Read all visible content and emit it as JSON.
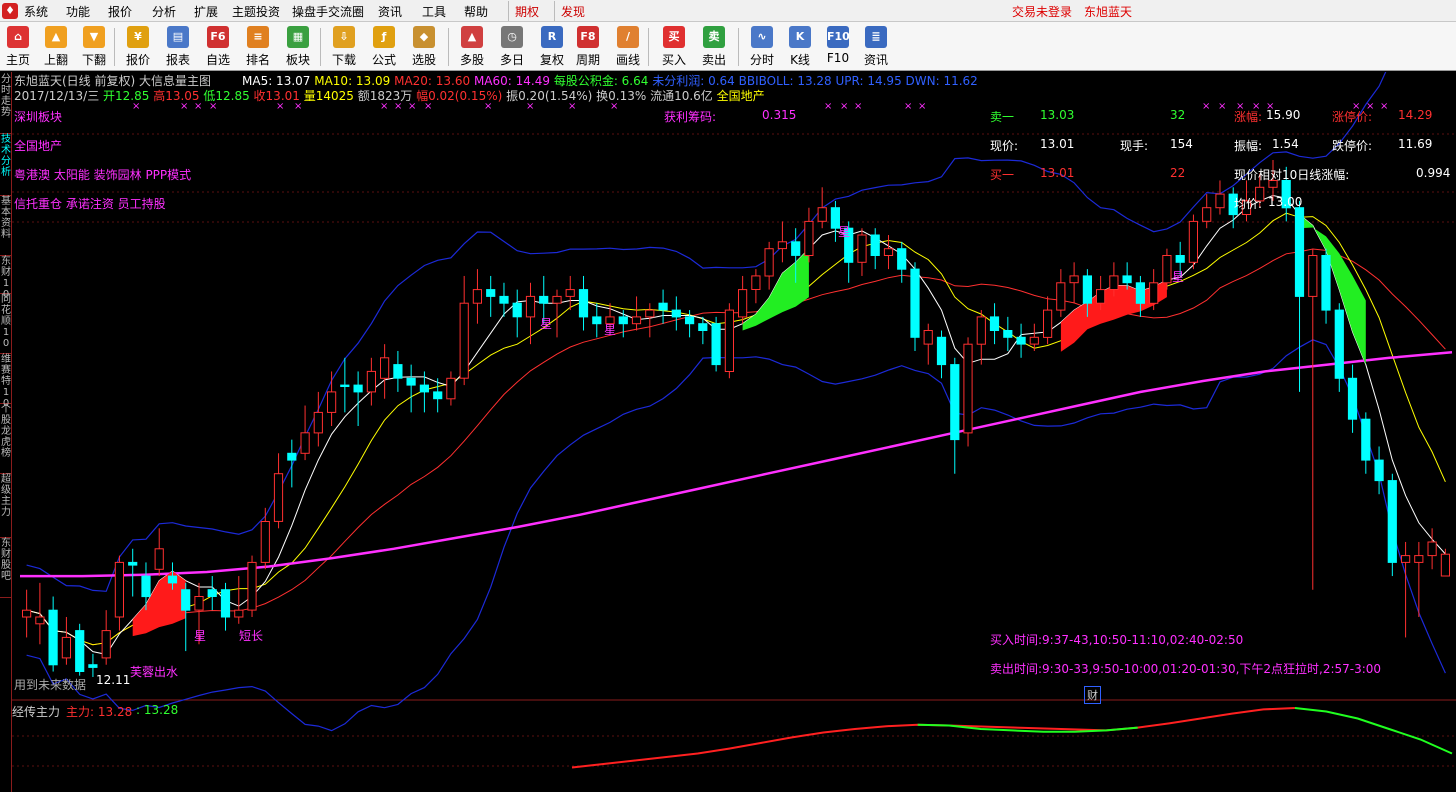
{
  "menubar": {
    "items": [
      "系统",
      "功能",
      "报价",
      "分析",
      "扩展",
      "主题投资",
      "操盘手交流圈",
      "资讯",
      "工具",
      "帮助"
    ],
    "special": [
      "期权",
      "发现"
    ],
    "login_status": "交易未登录",
    "stock_name": "东旭蓝天"
  },
  "toolbar": {
    "buttons": [
      {
        "label": "主页",
        "icon": "home-icon",
        "color": "#d33"
      },
      {
        "label": "上翻",
        "icon": "arrow-up-icon",
        "color": "#f0a020"
      },
      {
        "label": "下翻",
        "icon": "arrow-down-icon",
        "color": "#f0a020"
      },
      {
        "label": "报价",
        "icon": "yen-icon",
        "color": "#e0a010"
      },
      {
        "label": "报表",
        "icon": "report-icon",
        "color": "#4a78c8"
      },
      {
        "label": "自选",
        "icon": "f6-icon",
        "color": "#d03030"
      },
      {
        "label": "排名",
        "icon": "rank-icon",
        "color": "#e08020"
      },
      {
        "label": "板块",
        "icon": "grid-icon",
        "color": "#3aa040"
      },
      {
        "label": "下载",
        "icon": "download-icon",
        "color": "#e0a020"
      },
      {
        "label": "公式",
        "icon": "formula-icon",
        "color": "#e0a010"
      },
      {
        "label": "选股",
        "icon": "select-stock-icon",
        "color": "#c89030"
      },
      {
        "label": "多股",
        "icon": "multi-stock-icon",
        "color": "#d04040"
      },
      {
        "label": "多日",
        "icon": "clock-icon",
        "color": "#777"
      },
      {
        "label": "复权",
        "icon": "restore-rights-icon",
        "color": "#3a6ac0"
      },
      {
        "label": "周期",
        "icon": "f8-icon",
        "color": "#d03030"
      },
      {
        "label": "画线",
        "icon": "draw-line-icon",
        "color": "#e08030"
      },
      {
        "label": "买入",
        "icon": "buy-icon",
        "color": "#e03030"
      },
      {
        "label": "卖出",
        "icon": "sell-icon",
        "color": "#30a040"
      },
      {
        "label": "分时",
        "icon": "timeshare-icon",
        "color": "#4a78c8"
      },
      {
        "label": "K线",
        "icon": "kline-icon",
        "color": "#4a78c8"
      },
      {
        "label": "F10",
        "icon": "f10-icon",
        "color": "#3a6ac0"
      },
      {
        "label": "资讯",
        "icon": "news-icon",
        "color": "#3a6ac0"
      }
    ]
  },
  "sidetabs": [
    "分时走势",
    "技术分析",
    "基本资料",
    "东财10",
    "同花顺10",
    "维赛特10",
    "个股龙虎榜",
    "超级主力",
    "东财股吧"
  ],
  "header": {
    "title": "东旭蓝天(日线 前复权) 大信息量主图",
    "ma": [
      {
        "text": "MA5: 13.07",
        "color": "#ffffff"
      },
      {
        "text": "MA10: 13.09",
        "color": "#ffff00"
      },
      {
        "text": "MA20: 13.60",
        "color": "#ff3030"
      },
      {
        "text": "MA60: 14.49",
        "color": "#ff30ff"
      },
      {
        "text": "每股公积金: 6.64",
        "color": "#30ff30"
      },
      {
        "text": "未分利润: 0.64",
        "color": "#3060ff"
      },
      {
        "text": "BBIBOLL: 13.28",
        "color": "#3060ff"
      },
      {
        "text": "UPR: 14.95",
        "color": "#3060ff"
      },
      {
        "text": "DWN: 11.62",
        "color": "#3060ff"
      }
    ],
    "quote_line": [
      {
        "text": "2017/12/13/三",
        "color": "#cccccc"
      },
      {
        "text": "开12.85",
        "color": "#30ff30"
      },
      {
        "text": "高13.05",
        "color": "#ff3030"
      },
      {
        "text": "低12.85",
        "color": "#30ff30"
      },
      {
        "text": "收13.01",
        "color": "#ff3030"
      },
      {
        "text": "量14025",
        "color": "#ffff00"
      },
      {
        "text": "额1823万",
        "color": "#cccccc"
      },
      {
        "text": "幅0.02(0.15%)",
        "color": "#ff3030"
      },
      {
        "text": "振0.20(1.54%)",
        "color": "#cccccc"
      },
      {
        "text": "换0.13%",
        "color": "#cccccc"
      },
      {
        "text": "流通10.6亿",
        "color": "#cccccc"
      },
      {
        "text": "全国地产",
        "color": "#ffff00"
      }
    ]
  },
  "info_left": {
    "sector_title": "深圳板块",
    "region": "全国地产",
    "concepts1": "粤港澳 太阳能 装饰园林 PPP模式",
    "concepts2": "信托重仓 承诺注资 员工持股",
    "profit_chip_label": "获利筹码:",
    "profit_chip_value": "0.315"
  },
  "quote_panel": {
    "sell1_label": "卖一",
    "sell1_price": "13.03",
    "sell1_vol": "32",
    "limit_label": "涨幅:",
    "limit_value": "15.90",
    "limit_up_label": "涨停价:",
    "limit_up_value": "14.29",
    "price_label": "现价:",
    "price_value": "13.01",
    "hand_label": "现手:",
    "hand_value": "154",
    "amp_label": "振幅:",
    "amp_value": "1.54",
    "limit_down_label": "跌停价:",
    "limit_down_value": "11.69",
    "buy1_label": "买一",
    "buy1_price": "13.01",
    "buy1_vol": "22",
    "rel10_label": "现价相对10日线涨幅:",
    "rel10_value": "0.994",
    "avg_label": "均价:",
    "avg_value": "13.00"
  },
  "chart_notes": {
    "low_price_label": "12.11",
    "future_data_note": "用到未来数据",
    "pattern_label": "芙蓉出水",
    "star_labels": [
      "星",
      "星",
      "星",
      "星",
      "星"
    ],
    "short_long_label": "短长",
    "buy_time": "买入时间:9:37-43,10:50-11:10,02:40-02:50",
    "sell_time": "卖出时间:9:30-33,9:50-10:00,01:20-01:30,下午2点狂拉时,2:57-3:00",
    "finance_marker": "财"
  },
  "sub_chart": {
    "title": "经传主力",
    "main_label": "主力: 13.28",
    "second_label": ": 13.28"
  },
  "colors": {
    "up": "#ff3030",
    "down": "#00ffff",
    "ma5": "#ffffff",
    "ma10": "#ffff00",
    "ma20": "#ff3030",
    "ma60": "#ff30ff",
    "boll": "#1c2ad8",
    "marker": "#ff30ff"
  },
  "chart_data": {
    "type": "candlestick",
    "y_ref": {
      "high": 15.9,
      "low": 12.11
    },
    "candles": [
      {
        "o": 12.55,
        "c": 12.6,
        "h": 12.75,
        "l": 12.4
      },
      {
        "o": 12.5,
        "c": 12.55,
        "h": 12.8,
        "l": 12.35
      },
      {
        "o": 12.6,
        "c": 12.2,
        "h": 12.7,
        "l": 12.15
      },
      {
        "o": 12.25,
        "c": 12.4,
        "h": 12.55,
        "l": 12.2
      },
      {
        "o": 12.45,
        "c": 12.15,
        "h": 12.5,
        "l": 12.12
      },
      {
        "o": 12.2,
        "c": 12.18,
        "h": 12.28,
        "l": 12.11
      },
      {
        "o": 12.25,
        "c": 12.45,
        "h": 12.6,
        "l": 12.2
      },
      {
        "o": 12.55,
        "c": 12.95,
        "h": 13.0,
        "l": 12.45
      },
      {
        "o": 12.95,
        "c": 12.93,
        "h": 13.05,
        "l": 12.7
      },
      {
        "o": 12.85,
        "c": 12.7,
        "h": 12.95,
        "l": 12.6
      },
      {
        "o": 12.9,
        "c": 13.05,
        "h": 13.2,
        "l": 12.85
      },
      {
        "o": 12.85,
        "c": 12.8,
        "h": 12.95,
        "l": 12.75
      },
      {
        "o": 12.75,
        "c": 12.6,
        "h": 12.8,
        "l": 12.3
      },
      {
        "o": 12.6,
        "c": 12.7,
        "h": 12.8,
        "l": 12.35
      },
      {
        "o": 12.75,
        "c": 12.7,
        "h": 12.85,
        "l": 12.6
      },
      {
        "o": 12.75,
        "c": 12.55,
        "h": 12.8,
        "l": 12.45
      },
      {
        "o": 12.55,
        "c": 12.6,
        "h": 12.85,
        "l": 12.5
      },
      {
        "o": 12.6,
        "c": 12.95,
        "h": 13.0,
        "l": 12.55
      },
      {
        "o": 12.95,
        "c": 13.25,
        "h": 13.35,
        "l": 12.9
      },
      {
        "o": 13.25,
        "c": 13.6,
        "h": 13.75,
        "l": 13.2
      },
      {
        "o": 13.75,
        "c": 13.7,
        "h": 13.85,
        "l": 13.5
      },
      {
        "o": 13.75,
        "c": 13.9,
        "h": 14.1,
        "l": 13.7
      },
      {
        "o": 13.9,
        "c": 14.05,
        "h": 14.2,
        "l": 13.8
      },
      {
        "o": 14.05,
        "c": 14.2,
        "h": 14.35,
        "l": 13.95
      },
      {
        "o": 14.25,
        "c": 14.24,
        "h": 14.45,
        "l": 14.05
      },
      {
        "o": 14.25,
        "c": 14.2,
        "h": 14.35,
        "l": 13.95
      },
      {
        "o": 14.2,
        "c": 14.35,
        "h": 14.45,
        "l": 14.1
      },
      {
        "o": 14.3,
        "c": 14.45,
        "h": 14.55,
        "l": 14.15
      },
      {
        "o": 14.4,
        "c": 14.3,
        "h": 14.5,
        "l": 14.2
      },
      {
        "o": 14.3,
        "c": 14.25,
        "h": 14.4,
        "l": 14.05
      },
      {
        "o": 14.25,
        "c": 14.2,
        "h": 14.35,
        "l": 14.05
      },
      {
        "o": 14.2,
        "c": 14.15,
        "h": 14.3,
        "l": 14.05
      },
      {
        "o": 14.15,
        "c": 14.3,
        "h": 14.35,
        "l": 14.1
      },
      {
        "o": 14.3,
        "c": 14.85,
        "h": 15.05,
        "l": 14.25
      },
      {
        "o": 14.85,
        "c": 14.95,
        "h": 15.1,
        "l": 14.7
      },
      {
        "o": 14.95,
        "c": 14.9,
        "h": 15.05,
        "l": 14.75
      },
      {
        "o": 14.9,
        "c": 14.85,
        "h": 15.0,
        "l": 14.75
      },
      {
        "o": 14.85,
        "c": 14.75,
        "h": 14.95,
        "l": 14.6
      },
      {
        "o": 14.75,
        "c": 14.9,
        "h": 15.0,
        "l": 14.55
      },
      {
        "o": 14.9,
        "c": 14.85,
        "h": 15.05,
        "l": 14.7
      },
      {
        "o": 14.85,
        "c": 14.9,
        "h": 14.95,
        "l": 14.6
      },
      {
        "o": 14.9,
        "c": 14.95,
        "h": 15.05,
        "l": 14.8
      },
      {
        "o": 14.95,
        "c": 14.75,
        "h": 15.05,
        "l": 14.65
      },
      {
        "o": 14.75,
        "c": 14.7,
        "h": 14.85,
        "l": 14.6
      },
      {
        "o": 14.7,
        "c": 14.75,
        "h": 14.85,
        "l": 14.65
      },
      {
        "o": 14.75,
        "c": 14.7,
        "h": 14.8,
        "l": 14.6
      },
      {
        "o": 14.7,
        "c": 14.75,
        "h": 14.9,
        "l": 14.65
      },
      {
        "o": 14.75,
        "c": 14.8,
        "h": 14.85,
        "l": 14.6
      },
      {
        "o": 14.85,
        "c": 14.8,
        "h": 14.95,
        "l": 14.7
      },
      {
        "o": 14.8,
        "c": 14.75,
        "h": 14.9,
        "l": 14.65
      },
      {
        "o": 14.75,
        "c": 14.7,
        "h": 14.8,
        "l": 14.6
      },
      {
        "o": 14.7,
        "c": 14.65,
        "h": 14.75,
        "l": 14.55
      },
      {
        "o": 14.7,
        "c": 14.4,
        "h": 14.75,
        "l": 14.35
      },
      {
        "o": 14.35,
        "c": 14.8,
        "h": 14.85,
        "l": 14.3
      },
      {
        "o": 14.75,
        "c": 14.95,
        "h": 15.05,
        "l": 14.7
      },
      {
        "o": 14.95,
        "c": 15.05,
        "h": 15.1,
        "l": 14.85
      },
      {
        "o": 15.05,
        "c": 15.25,
        "h": 15.3,
        "l": 14.95
      },
      {
        "o": 15.25,
        "c": 15.3,
        "h": 15.45,
        "l": 15.15
      },
      {
        "o": 15.3,
        "c": 15.2,
        "h": 15.4,
        "l": 15.0
      },
      {
        "o": 15.2,
        "c": 15.45,
        "h": 15.55,
        "l": 15.15
      },
      {
        "o": 15.45,
        "c": 15.55,
        "h": 15.7,
        "l": 15.4
      },
      {
        "o": 15.55,
        "c": 15.4,
        "h": 15.6,
        "l": 15.3
      },
      {
        "o": 15.4,
        "c": 15.15,
        "h": 15.45,
        "l": 15.0
      },
      {
        "o": 15.15,
        "c": 15.35,
        "h": 15.4,
        "l": 15.05
      },
      {
        "o": 15.35,
        "c": 15.2,
        "h": 15.4,
        "l": 15.1
      },
      {
        "o": 15.2,
        "c": 15.25,
        "h": 15.35,
        "l": 15.1
      },
      {
        "o": 15.25,
        "c": 15.1,
        "h": 15.3,
        "l": 15.0
      },
      {
        "o": 15.1,
        "c": 14.6,
        "h": 15.15,
        "l": 14.5
      },
      {
        "o": 14.55,
        "c": 14.65,
        "h": 14.7,
        "l": 14.4
      },
      {
        "o": 14.6,
        "c": 14.4,
        "h": 14.65,
        "l": 14.3
      },
      {
        "o": 14.4,
        "c": 13.85,
        "h": 14.45,
        "l": 13.6
      },
      {
        "o": 13.9,
        "c": 14.55,
        "h": 14.6,
        "l": 13.8
      },
      {
        "o": 14.55,
        "c": 14.75,
        "h": 14.8,
        "l": 14.4
      },
      {
        "o": 14.75,
        "c": 14.65,
        "h": 14.85,
        "l": 14.55
      },
      {
        "o": 14.65,
        "c": 14.6,
        "h": 14.75,
        "l": 14.5
      },
      {
        "o": 14.6,
        "c": 14.55,
        "h": 14.7,
        "l": 14.45
      },
      {
        "o": 14.55,
        "c": 14.6,
        "h": 14.7,
        "l": 14.5
      },
      {
        "o": 14.6,
        "c": 14.8,
        "h": 14.9,
        "l": 14.55
      },
      {
        "o": 14.8,
        "c": 15.0,
        "h": 15.1,
        "l": 14.75
      },
      {
        "o": 15.0,
        "c": 15.05,
        "h": 15.15,
        "l": 14.85
      },
      {
        "o": 15.05,
        "c": 14.85,
        "h": 15.1,
        "l": 14.75
      },
      {
        "o": 14.85,
        "c": 14.95,
        "h": 15.05,
        "l": 14.8
      },
      {
        "o": 14.95,
        "c": 15.05,
        "h": 15.15,
        "l": 14.9
      },
      {
        "o": 15.05,
        "c": 15.0,
        "h": 15.15,
        "l": 14.95
      },
      {
        "o": 15.0,
        "c": 14.85,
        "h": 15.05,
        "l": 14.75
      },
      {
        "o": 14.85,
        "c": 15.0,
        "h": 15.1,
        "l": 14.8
      },
      {
        "o": 15.0,
        "c": 15.2,
        "h": 15.25,
        "l": 14.95
      },
      {
        "o": 15.2,
        "c": 15.15,
        "h": 15.3,
        "l": 15.05
      },
      {
        "o": 15.15,
        "c": 15.45,
        "h": 15.5,
        "l": 15.1
      },
      {
        "o": 15.45,
        "c": 15.55,
        "h": 15.65,
        "l": 15.4
      },
      {
        "o": 15.55,
        "c": 15.65,
        "h": 15.75,
        "l": 15.5
      },
      {
        "o": 15.65,
        "c": 15.5,
        "h": 15.7,
        "l": 15.4
      },
      {
        "o": 15.5,
        "c": 15.6,
        "h": 15.75,
        "l": 15.45
      },
      {
        "o": 15.6,
        "c": 15.7,
        "h": 15.8,
        "l": 15.55
      },
      {
        "o": 15.7,
        "c": 15.75,
        "h": 15.9,
        "l": 15.6
      },
      {
        "o": 15.75,
        "c": 15.55,
        "h": 15.85,
        "l": 15.45
      },
      {
        "o": 15.55,
        "c": 14.9,
        "h": 15.6,
        "l": 14.2
      },
      {
        "o": 14.9,
        "c": 15.2,
        "h": 15.25,
        "l": 12.75
      },
      {
        "o": 15.2,
        "c": 14.8,
        "h": 15.25,
        "l": 14.7
      },
      {
        "o": 14.8,
        "c": 14.3,
        "h": 14.85,
        "l": 14.2
      },
      {
        "o": 14.3,
        "c": 14.0,
        "h": 14.4,
        "l": 13.9
      },
      {
        "o": 14.0,
        "c": 13.7,
        "h": 14.05,
        "l": 13.6
      },
      {
        "o": 13.7,
        "c": 13.55,
        "h": 13.8,
        "l": 13.45
      },
      {
        "o": 13.55,
        "c": 12.95,
        "h": 13.6,
        "l": 12.85
      },
      {
        "o": 12.95,
        "c": 13.0,
        "h": 13.1,
        "l": 12.4
      },
      {
        "o": 12.95,
        "c": 13.0,
        "h": 13.1,
        "l": 12.55
      },
      {
        "o": 13.0,
        "c": 13.1,
        "h": 13.2,
        "l": 12.9
      },
      {
        "o": 12.85,
        "c": 13.01,
        "h": 13.05,
        "l": 12.85
      }
    ],
    "ma60_points": [
      12.85,
      12.85,
      12.86,
      12.88,
      12.92,
      12.98,
      13.05,
      13.13,
      13.21,
      13.3,
      13.4,
      13.5,
      13.6,
      13.7,
      13.8,
      13.9,
      14.0,
      14.1,
      14.2,
      14.28,
      14.35,
      14.4,
      14.45,
      14.49
    ],
    "sub_series": [
      0.35,
      0.4,
      0.45,
      0.5,
      0.55,
      0.62,
      0.7,
      0.78,
      0.85,
      0.9,
      0.94,
      0.96,
      0.95,
      0.9,
      0.88,
      0.86,
      0.86,
      0.88,
      0.92,
      0.98,
      1.05,
      1.12,
      1.18,
      1.2,
      1.15,
      1.05,
      0.9,
      0.75,
      0.55
    ]
  }
}
